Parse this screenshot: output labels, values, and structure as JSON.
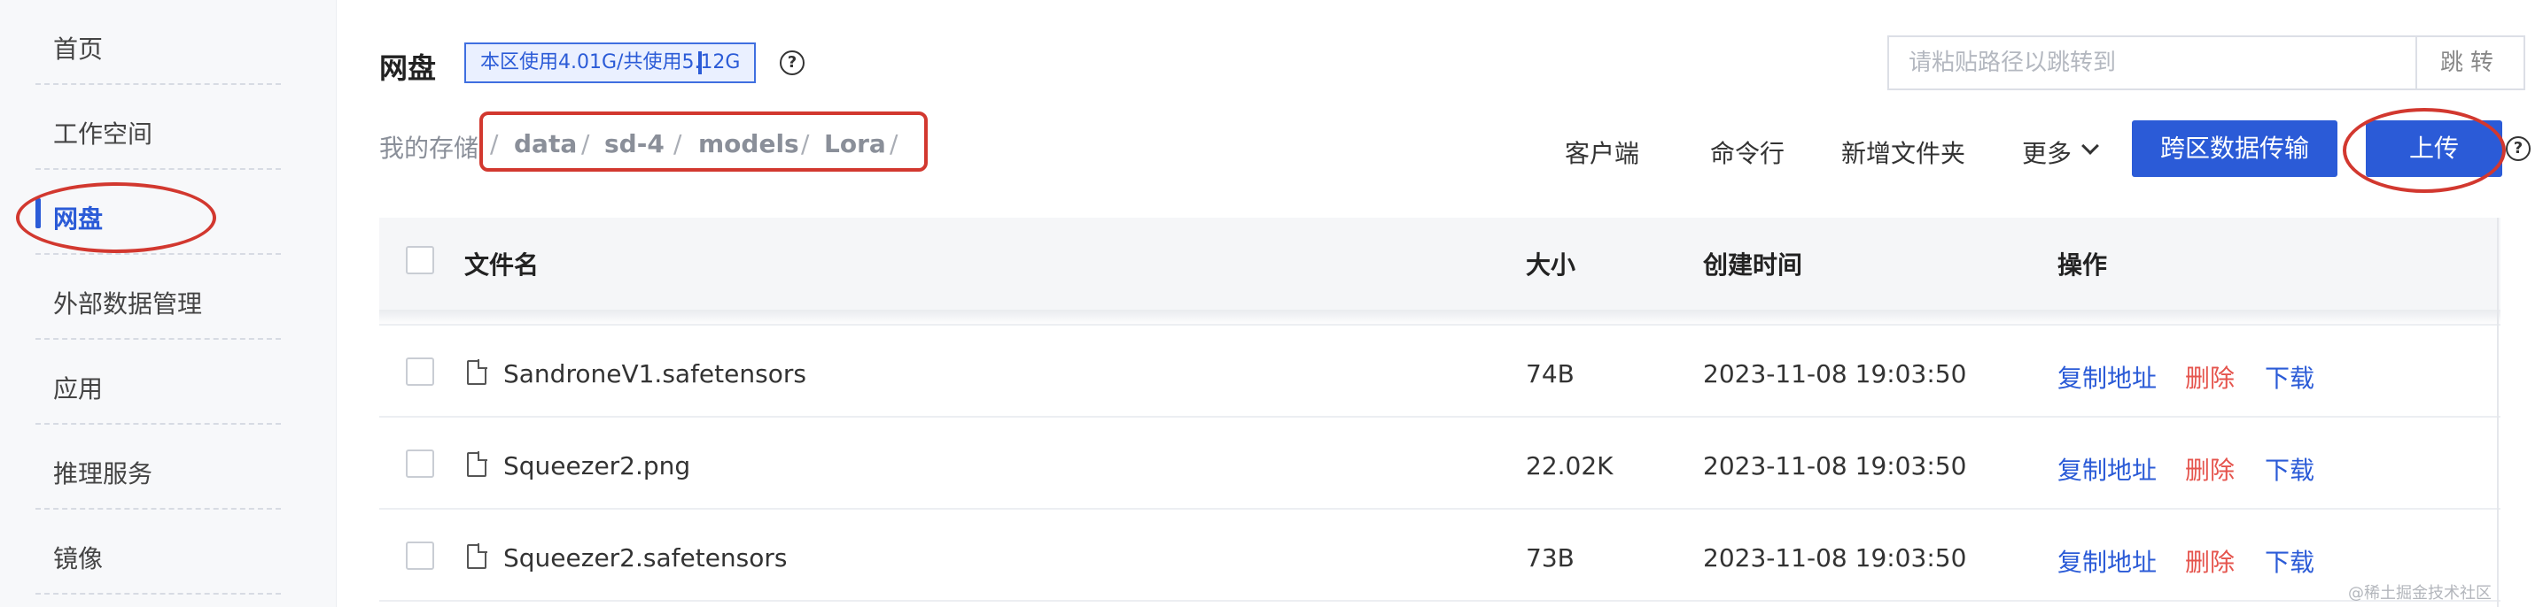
{
  "sidebar": {
    "items": [
      {
        "label": "首页"
      },
      {
        "label": "工作空间"
      },
      {
        "label": "网盘"
      },
      {
        "label": "外部数据管理"
      },
      {
        "label": "应用"
      },
      {
        "label": "推理服务"
      },
      {
        "label": "镜像"
      }
    ],
    "active_index": 2
  },
  "header": {
    "title": "网盘",
    "usage": "本区使用4.01G/共使用5.12G",
    "help": "?",
    "path_placeholder": "请粘贴路径以跳转到",
    "jump_label": "跳转"
  },
  "breadcrumb": {
    "root": "我的存储",
    "parts": [
      "data",
      "sd-4",
      "models",
      "Lora"
    ],
    "separator": "/"
  },
  "toolbar": {
    "client": "客户端",
    "cli": "命令行",
    "new_folder": "新增文件夹",
    "more": "更多",
    "transfer": "跨区数据传输",
    "upload": "上传"
  },
  "table": {
    "columns": [
      "文件名",
      "大小",
      "创建时间",
      "操作"
    ],
    "rows": [
      {
        "name": "SandroneV1.safetensors",
        "size": "74B",
        "created": "2023-11-08 19:03:50"
      },
      {
        "name": "Squeezer2.png",
        "size": "22.02K",
        "created": "2023-11-08 19:03:50"
      },
      {
        "name": "Squeezer2.safetensors",
        "size": "73B",
        "created": "2023-11-08 19:03:50"
      }
    ],
    "actions": {
      "copy": "复制地址",
      "delete": "删除",
      "download": "下载"
    }
  },
  "watermark": "@稀土掘金技术社区",
  "colors": {
    "accent": "#2b5bd7",
    "danger": "#e5544d",
    "annotation": "#d2382f"
  }
}
